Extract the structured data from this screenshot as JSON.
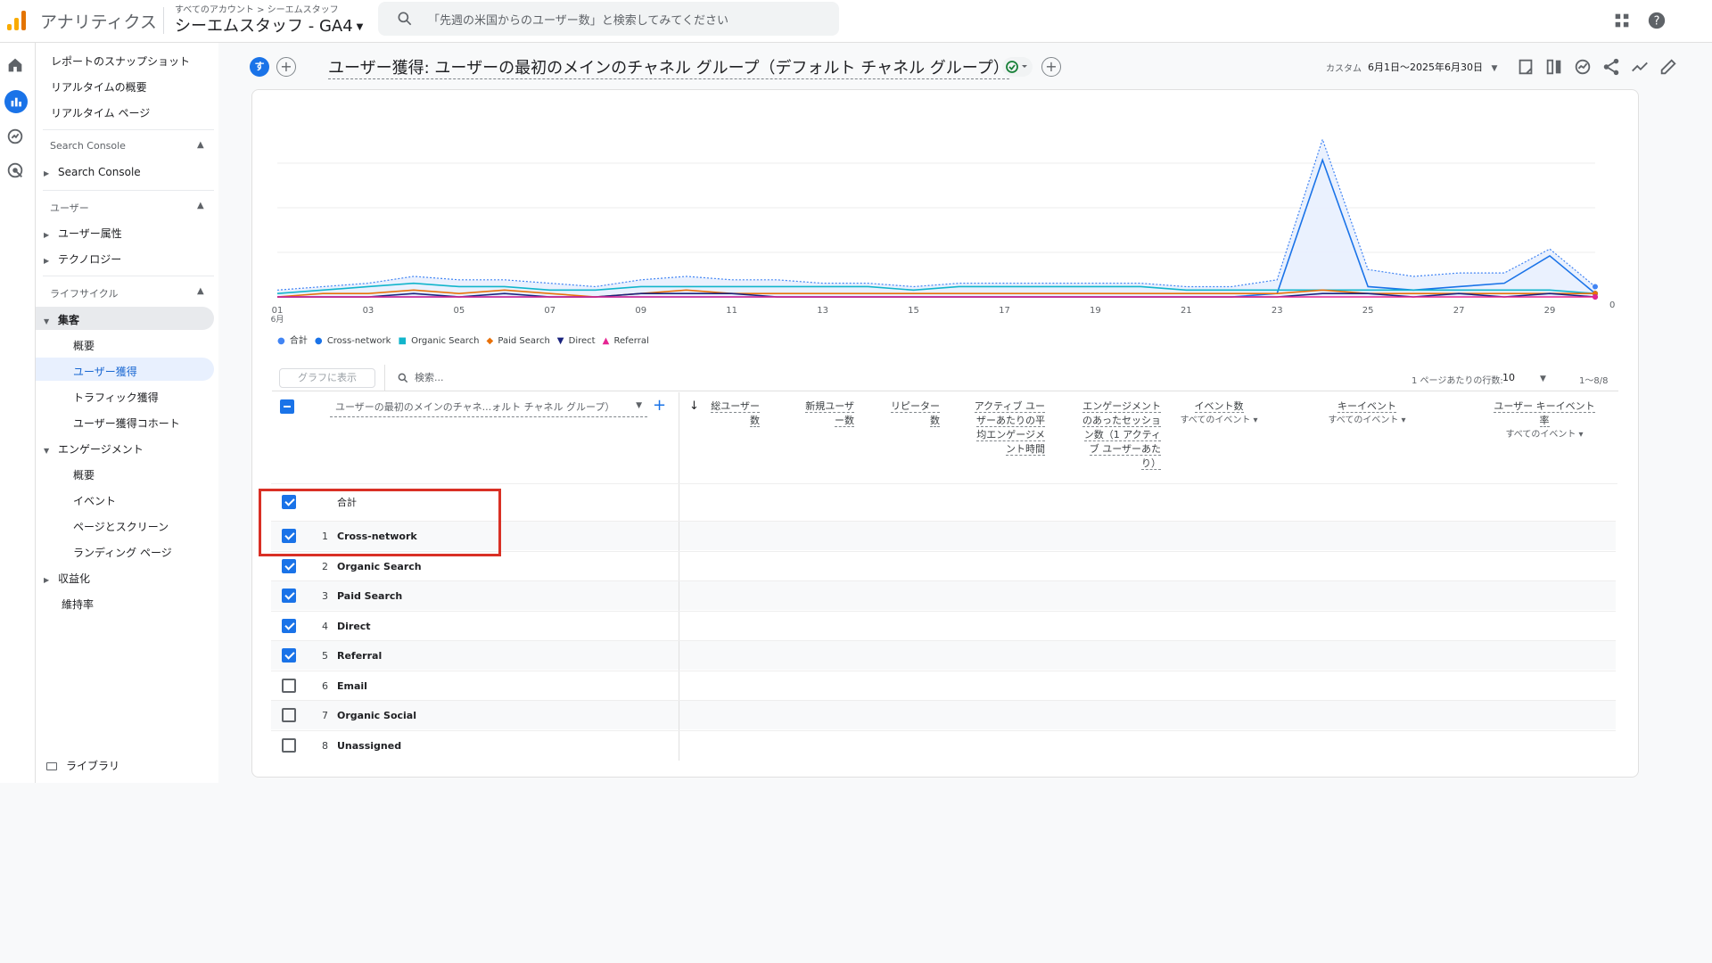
{
  "topbar": {
    "product": "アナリティクス",
    "breadcrumb": "すべてのアカウント > シーエムスタッフ",
    "property": "シーエムスタッフ - GA4",
    "search_placeholder": "「先週の米国からのユーザー数」と検索してみてください"
  },
  "sidebar": {
    "top_links": [
      "レポートのスナップショット",
      "リアルタイムの概要",
      "リアルタイム ページ"
    ],
    "section_search_console": "Search Console",
    "search_console_item": "Search Console",
    "section_user": "ユーザー",
    "user_items": [
      "ユーザー属性",
      "テクノロジー"
    ],
    "section_lifecycle": "ライフサイクル",
    "acquisition": "集客",
    "acquisition_items": [
      "概要",
      "ユーザー獲得",
      "トラフィック獲得",
      "ユーザー獲得コホート"
    ],
    "engagement": "エンゲージメント",
    "engagement_items": [
      "概要",
      "イベント",
      "ページとスクリーン",
      "ランディング ページ"
    ],
    "monetization": "収益化",
    "retention": "維持率",
    "library": "ライブラリ"
  },
  "header": {
    "badge": "す",
    "title": "ユーザー獲得: ユーザーの最初のメインのチャネル グループ（デフォルト チャネル グループ）",
    "date_label": "カスタム",
    "date_range": "6月1日～2025年6月30日"
  },
  "chart_data": {
    "type": "line",
    "x": [
      "01",
      "02",
      "03",
      "04",
      "05",
      "06",
      "07",
      "08",
      "09",
      "10",
      "11",
      "12",
      "13",
      "14",
      "15",
      "16",
      "17",
      "18",
      "19",
      "20",
      "21",
      "22",
      "23",
      "24",
      "25",
      "26",
      "27",
      "28",
      "29",
      "30"
    ],
    "x_tick_labels": [
      "01",
      "03",
      "05",
      "07",
      "09",
      "11",
      "13",
      "15",
      "17",
      "19",
      "21",
      "23",
      "25",
      "27",
      "29"
    ],
    "x_month_label": "6月",
    "y_zero_label": "0",
    "series": [
      {
        "name": "合計",
        "color": "#4285f4",
        "values": [
          2,
          3,
          4,
          6,
          5,
          5,
          4,
          3,
          5,
          6,
          5,
          5,
          4,
          4,
          3,
          4,
          4,
          4,
          4,
          4,
          3,
          3,
          5,
          46,
          8,
          6,
          7,
          7,
          14,
          3
        ]
      },
      {
        "name": "Cross-network",
        "color": "#1a73e8",
        "values": [
          0,
          0,
          0,
          0,
          0,
          0,
          0,
          0,
          0,
          0,
          0,
          0,
          0,
          0,
          0,
          0,
          0,
          0,
          0,
          0,
          0,
          0,
          1,
          40,
          3,
          2,
          3,
          4,
          12,
          1
        ]
      },
      {
        "name": "Organic Search",
        "color": "#12b5cb",
        "values": [
          1,
          2,
          3,
          4,
          3,
          3,
          2,
          2,
          3,
          3,
          3,
          3,
          3,
          3,
          2,
          3,
          3,
          3,
          3,
          3,
          2,
          2,
          2,
          2,
          2,
          2,
          2,
          2,
          2,
          1
        ]
      },
      {
        "name": "Paid Search",
        "color": "#e8710a",
        "values": [
          0,
          1,
          1,
          2,
          1,
          2,
          1,
          0,
          1,
          2,
          1,
          1,
          1,
          1,
          1,
          1,
          1,
          1,
          1,
          1,
          1,
          1,
          1,
          2,
          1,
          1,
          1,
          1,
          1,
          1
        ]
      },
      {
        "name": "Direct",
        "color": "#1a237e",
        "values": [
          0,
          0,
          0,
          1,
          0,
          1,
          0,
          0,
          1,
          1,
          1,
          0,
          0,
          0,
          0,
          0,
          0,
          0,
          0,
          0,
          0,
          0,
          0,
          1,
          1,
          0,
          1,
          0,
          1,
          0
        ]
      },
      {
        "name": "Referral",
        "color": "#e52592",
        "values": [
          0,
          0,
          0,
          0,
          0,
          0,
          0,
          0,
          0,
          0,
          0,
          0,
          0,
          0,
          0,
          0,
          0,
          0,
          0,
          0,
          0,
          0,
          0,
          0,
          0,
          0,
          0,
          0,
          0,
          0
        ]
      }
    ]
  },
  "table": {
    "graph_button": "グラフに表示",
    "search_placeholder": "検索...",
    "rows_per_page_label": "1 ページあたりの行数:",
    "rows_per_page": "10",
    "pager": "1～8/8",
    "dimension": "ユーザーの最初のメインのチャネ...ォルト チャネル グループ）",
    "columns": [
      {
        "label": "総ユーザー数",
        "lines": [
          "総ユーザー",
          "数"
        ],
        "sub": ""
      },
      {
        "label": "新規ユーザー数",
        "lines": [
          "新規ユーザ",
          "ー数"
        ],
        "sub": ""
      },
      {
        "label": "リピーター数",
        "lines": [
          "リピーター",
          "数"
        ],
        "sub": ""
      },
      {
        "label": "アクティブ ユーザーあたりの平均エンゲージメント時間",
        "lines": [
          "アクティブ ユー",
          "ザーあたりの平",
          "均エンゲージメ",
          "ント時間"
        ],
        "sub": ""
      },
      {
        "label": "エンゲージメントのあったセッション数（1 アクティブ ユーザーあたり）",
        "lines": [
          "エンゲージメント",
          "のあったセッショ",
          "ン数（1 アクティ",
          "ブ ユーザーあた",
          "り）"
        ],
        "sub": ""
      },
      {
        "label": "イベント数",
        "lines": [
          "イベント数"
        ],
        "sub": "すべてのイベント"
      },
      {
        "label": "キーイベント",
        "lines": [
          "キーイベント"
        ],
        "sub": "すべてのイベント"
      },
      {
        "label": "ユーザー キーイベント率",
        "lines": [
          "ユーザー キーイベント",
          "率"
        ],
        "sub": "すべてのイベント"
      }
    ],
    "total_label": "合計",
    "rows": [
      {
        "num": "1",
        "label": "Cross-network",
        "checked": true
      },
      {
        "num": "2",
        "label": "Organic Search",
        "checked": true
      },
      {
        "num": "3",
        "label": "Paid Search",
        "checked": true
      },
      {
        "num": "4",
        "label": "Direct",
        "checked": true
      },
      {
        "num": "5",
        "label": "Referral",
        "checked": true
      },
      {
        "num": "6",
        "label": "Email",
        "checked": false
      },
      {
        "num": "7",
        "label": "Organic Social",
        "checked": false
      },
      {
        "num": "8",
        "label": "Unassigned",
        "checked": false
      }
    ]
  }
}
